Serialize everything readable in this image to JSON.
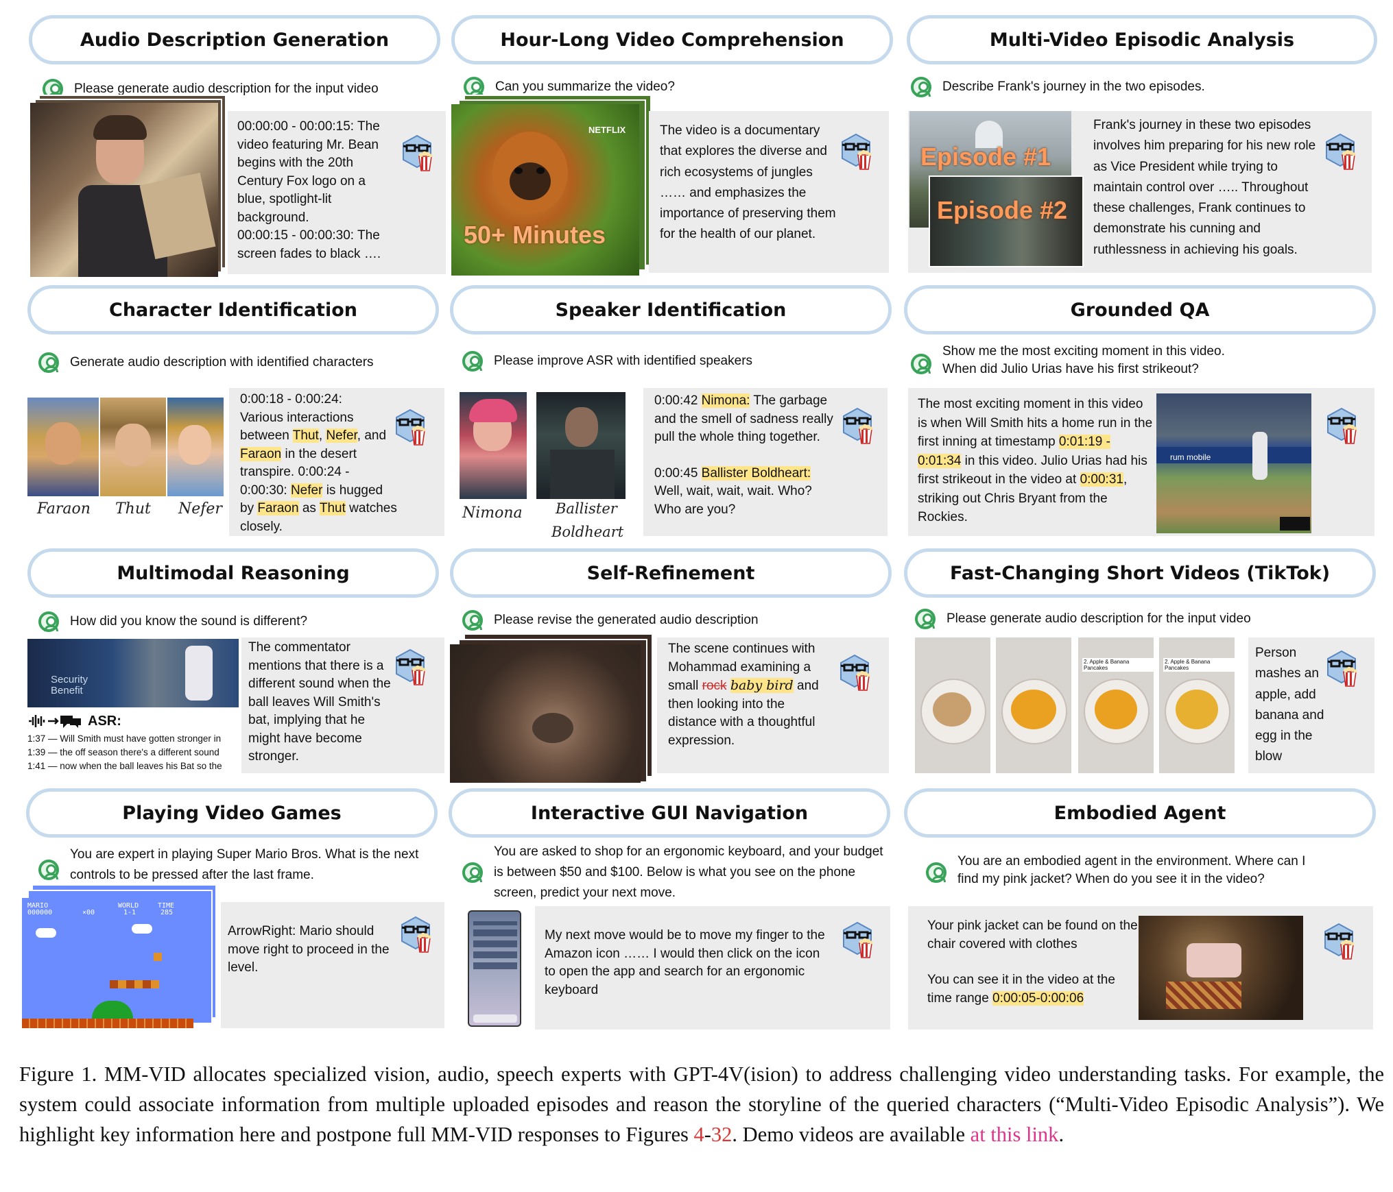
{
  "panels": {
    "audio_desc": {
      "title": "Audio Description Generation",
      "prompt": "Please generate audio description for the input video",
      "response": "00:00:00 - 00:00:15: The video featuring Mr. Bean begins with the 20th Century Fox logo on a blue, spotlight-lit background.\n00:00:15 - 00:00:30: The screen fades to black …."
    },
    "hour_long": {
      "title": "Hour-Long Video Comprehension",
      "prompt": "Can you summarize the video?",
      "overlay": "50+ Minutes",
      "netflix": "NETFLIX",
      "response": "The video is a documentary that explores the diverse and rich ecosystems of jungles …… and emphasizes the importance of preserving them for the health of our planet."
    },
    "multi_video": {
      "title": "Multi-Video Episodic Analysis",
      "prompt": "Describe Frank's journey in the two episodes.",
      "ep1": "Episode #1",
      "ep2": "Episode #2",
      "response": "Frank's journey in these two episodes involves him preparing for his new role as Vice President while trying to maintain control over ….. Throughout these challenges, Frank continues to demonstrate his cunning and ruthlessness in achieving his goals."
    },
    "character_id": {
      "title": "Character Identification",
      "prompt": "Generate audio description with identified characters",
      "names": [
        "Faraon",
        "Thut",
        "Nefer"
      ],
      "r1": "0:00:18 - 0:00:24:",
      "r2": "Various interactions between ",
      "r_thut": "Thut",
      "r_comma": ", ",
      "r_nefer": "Nefer",
      "r3": ",",
      "r4": "and ",
      "r_faraon": "Faraon",
      "r5": " in the desert transpire.",
      "r6": "0:00:24 - 0:00:30: ",
      "r_nefer2": "Nefer",
      "r7": "is hugged by ",
      "r_faraon2": "Faraon",
      "r8": " as",
      "r_thut2": "Thut",
      "r9": " watches closely."
    },
    "speaker_id": {
      "title": "Speaker Identification",
      "prompt": "Please improve ASR with identified speakers",
      "names": [
        "Nimona",
        "Ballister",
        "Boldheart"
      ],
      "t1": "0:00:42 ",
      "s1": "Nimona:",
      "l1": " The garbage and the smell of sadness really pull the whole thing together.",
      "t2": "0:00:45 ",
      "s2": "Ballister Boldheart:",
      "l2": "Well, wait, wait, wait. Who? Who are you?"
    },
    "grounded_qa": {
      "title": "Grounded QA",
      "prompt": "Show me the most exciting moment in this video.\nWhen did Julio Urias have his first strikeout?",
      "a1": "The most exciting moment in this video is when Will Smith hits a home run in the first inning at timestamp",
      "ts1": "0:01:19 - 0:01:34",
      "a2": " in this video.",
      "a3": "Julio Urias had his first strikeout in the video at ",
      "ts2": "0:00:31",
      "a4": ", striking out Chris Bryant from the Rockies.",
      "screen_text": "rum mobile"
    },
    "multimodal_reasoning": {
      "title": "Multimodal Reasoning",
      "prompt": "How did you know the sound is different?",
      "asr_label": "ASR:",
      "asr_lines": [
        "1:37 — Will Smith must have gotten stronger in",
        "1:39 — the off season there's a different sound",
        "1:41 — now when the ball leaves his Bat so the"
      ],
      "sign": "Security\nBenefit",
      "response": "The commentator mentions that there is a different sound when the ball leaves Will Smith's bat, implying that he might have become stronger."
    },
    "self_refinement": {
      "title": "Self-Refinement",
      "prompt": "Please revise the generated audio description",
      "r1": "The scene continues with Mohammad examining a small ",
      "strike": "rock",
      "insert": "baby bird",
      "r2": " and then looking into the distance with a thoughtful expression."
    },
    "tiktok": {
      "title": "Fast-Changing Short Videos (TikTok)",
      "prompt": "Please generate audio description for the input video",
      "frame_label": "2. Apple & Banana Pancakes",
      "response": "Person mashes an apple, add banana and egg in the blow"
    },
    "video_games": {
      "title": "Playing Video Games",
      "prompt": "You are expert in playing Super Mario Bros. What is the next controls to be pressed after the last frame.",
      "hud": [
        "MARIO",
        "WORLD",
        "TIME"
      ],
      "hud_vals": [
        "000000",
        "×00",
        "1-1",
        "285"
      ],
      "response": "ArrowRight: Mario should move right to proceed in the level."
    },
    "gui_nav": {
      "title": "Interactive GUI Navigation",
      "prompt": "You are asked to shop for an ergonomic keyboard, and your budget is between $50 and $100. Below is what you see on the phone  screen, predict your next move.",
      "response": "My next move would be to move my finger to the Amazon icon …… I would then click on the icon to open the app and search for an ergonomic keyboard"
    },
    "embodied": {
      "title": "Embodied Agent",
      "prompt": "You are an embodied agent in the environment. Where can I find my pink jacket? When do you see it in the video?",
      "r1": "Your pink jacket can be found on the chair covered with clothes",
      "r2": "You can see it in the video at the time range ",
      "ts": "0:00:05-0:00:06"
    }
  },
  "caption": {
    "fig": "Figure 1.",
    "p1": " MM-V",
    "id1": "ID",
    "p2": " allocates specialized vision, audio, speech experts with GPT-4V(ision) to address challenging video understanding tasks.  For example, the system could associate information from multiple uploaded episodes and reason the storyline of the queried characters (“Multi-Video Episodic Analysis”). We highlight key information here and postpone full MM-V",
    "id2": "ID",
    "p3": " responses to Figures ",
    "ref1": "4",
    "dash": "-",
    "ref2": "32",
    "p4": ". Demo videos are available ",
    "link": "at this link",
    "p5": "."
  },
  "colors": {
    "pill_border": "#c6daee",
    "user_icon": "#3aa35a",
    "highlight": "#ffe58a",
    "response_bg": "#ececec",
    "link": "#e0338a",
    "figure_ref": "#d93636"
  }
}
